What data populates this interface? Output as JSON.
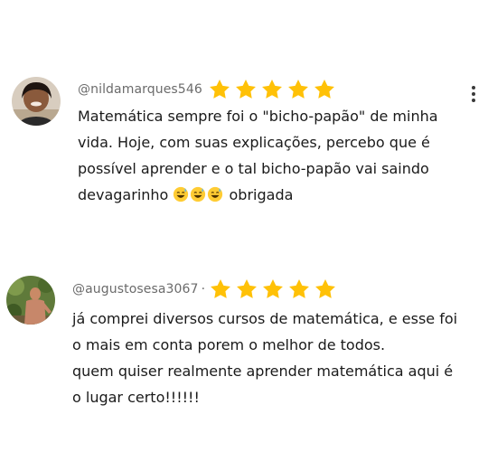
{
  "comments": [
    {
      "handle": "@nildamarques546",
      "rating": 5,
      "lines": [
        "Matemática sempre foi o \"bicho-papão\" de minha",
        "vida. Hoje, com suas explicações, percebo que é",
        "possível aprender e o tal bicho-papão vai saindo"
      ],
      "last_line_prefix": "devagarinho",
      "emoji_names": [
        "sweat-smile-emoji",
        "sweat-smile-emoji",
        "sweat-smile-emoji"
      ],
      "last_line_suffix": "obrigada",
      "menu_icon": "more-vert-icon"
    },
    {
      "handle": "@augustosesa3067",
      "separator": "·",
      "rating": 5,
      "lines": [
        "já comprei diversos cursos de matemática, e esse foi",
        "o mais em conta porem o melhor de todos.",
        "quem quiser realmente aprender matemática aqui  é",
        "o lugar certo!!!!!!"
      ]
    }
  ],
  "colors": {
    "star": "#FFC107",
    "handle": "#6b6b6b",
    "text": "#1a1a1a"
  }
}
